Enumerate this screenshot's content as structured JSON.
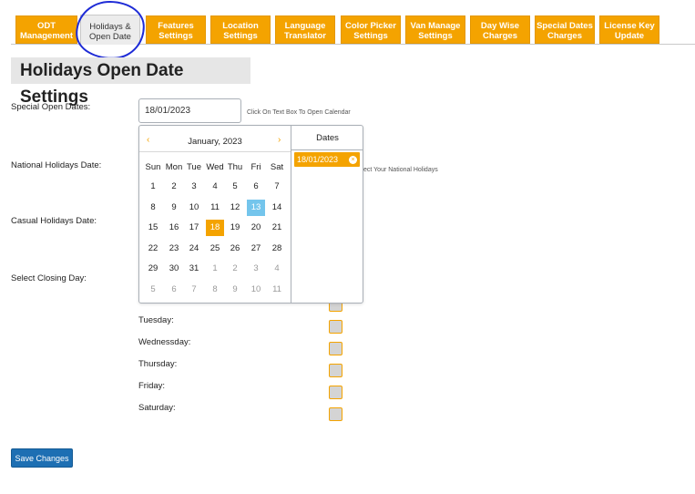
{
  "tabs": [
    {
      "line1": "ODT",
      "line2": "Management"
    },
    {
      "line1": "Holidays &",
      "line2": "Open Date"
    },
    {
      "line1": "Features",
      "line2": "Settings"
    },
    {
      "line1": "Location",
      "line2": "Settings"
    },
    {
      "line1": "Language",
      "line2": "Translator"
    },
    {
      "line1": "Color Picker",
      "line2": "Settings"
    },
    {
      "line1": "Van Manage",
      "line2": "Settings"
    },
    {
      "line1": "Day Wise",
      "line2": "Charges"
    },
    {
      "line1": "Special Dates",
      "line2": "Charges"
    },
    {
      "line1": "License Key",
      "line2": "Update"
    }
  ],
  "page_title": "Holidays Open Date Settings",
  "fields": {
    "special_open_label": "Special Open Dates:",
    "special_open_value": "18/01/2023",
    "special_open_hint": "Click On Text Box To Open Calendar",
    "national_label": "National Holidays Date:",
    "national_hint_partial": "ect Your National Holidays",
    "casual_label": "Casual Holidays Date:",
    "closing_label": "Select Closing Day:"
  },
  "calendar": {
    "prev": "‹",
    "next": "›",
    "month_label": "January, 2023",
    "weekdays": [
      "Sun",
      "Mon",
      "Tue",
      "Wed",
      "Thu",
      "Fri",
      "Sat"
    ],
    "weeks": [
      [
        "1",
        "2",
        "3",
        "4",
        "5",
        "6",
        "7"
      ],
      [
        "8",
        "9",
        "10",
        "11",
        "12",
        "13",
        "14"
      ],
      [
        "15",
        "16",
        "17",
        "18",
        "19",
        "20",
        "21"
      ],
      [
        "22",
        "23",
        "24",
        "25",
        "26",
        "27",
        "28"
      ],
      [
        "29",
        "30",
        "31",
        "1",
        "2",
        "3",
        "4"
      ],
      [
        "5",
        "6",
        "7",
        "8",
        "9",
        "10",
        "11"
      ]
    ],
    "other_month": [
      [
        4,
        3
      ],
      [
        4,
        4
      ],
      [
        4,
        5
      ],
      [
        4,
        6
      ],
      [
        5,
        0
      ],
      [
        5,
        1
      ],
      [
        5,
        2
      ],
      [
        5,
        3
      ],
      [
        5,
        4
      ],
      [
        5,
        5
      ],
      [
        5,
        6
      ]
    ],
    "selected_cell": [
      2,
      3
    ],
    "today_cell": [
      1,
      5
    ],
    "dates_header": "Dates",
    "selected_dates": [
      "18/01/2023"
    ]
  },
  "closing_days": [
    "Tuesday:",
    "Wednessday:",
    "Thursday:",
    "Friday:",
    "Saturday:"
  ],
  "checkbox_count": 8,
  "save_button": "Save Changes",
  "colors": {
    "accent": "#f4a300",
    "primary_button": "#1d6fb3",
    "today": "#74c5ec",
    "annotation": "#1e2bd6"
  }
}
